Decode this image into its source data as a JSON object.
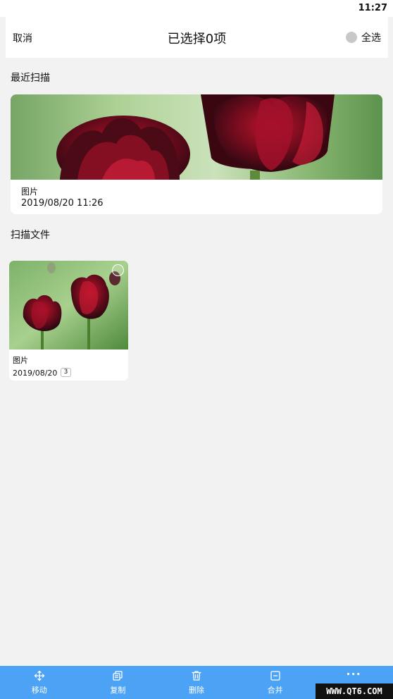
{
  "status_bar": {
    "time": "11:27"
  },
  "header": {
    "cancel_label": "取消",
    "title": "已选择0项",
    "select_all_label": "全选"
  },
  "recent": {
    "section_label": "最近扫描",
    "card": {
      "name": "图片",
      "date": "2019/08/20 11:26"
    }
  },
  "files": {
    "section_label": "扫描文件",
    "items": [
      {
        "name": "图片",
        "date": "2019/08/20",
        "count": "3"
      }
    ]
  },
  "toolbar": {
    "items": [
      {
        "label": "移动",
        "icon": "move-icon"
      },
      {
        "label": "复制",
        "icon": "copy-icon"
      },
      {
        "label": "删除",
        "icon": "trash-icon"
      },
      {
        "label": "合并",
        "icon": "merge-icon"
      },
      {
        "label": "",
        "icon": "more-icon"
      }
    ]
  },
  "watermark": "WWW.QT6.COM",
  "colors": {
    "toolbar_bg": "#4ca3f5",
    "page_bg": "#f2f2f3",
    "card_bg": "#ffffff"
  }
}
